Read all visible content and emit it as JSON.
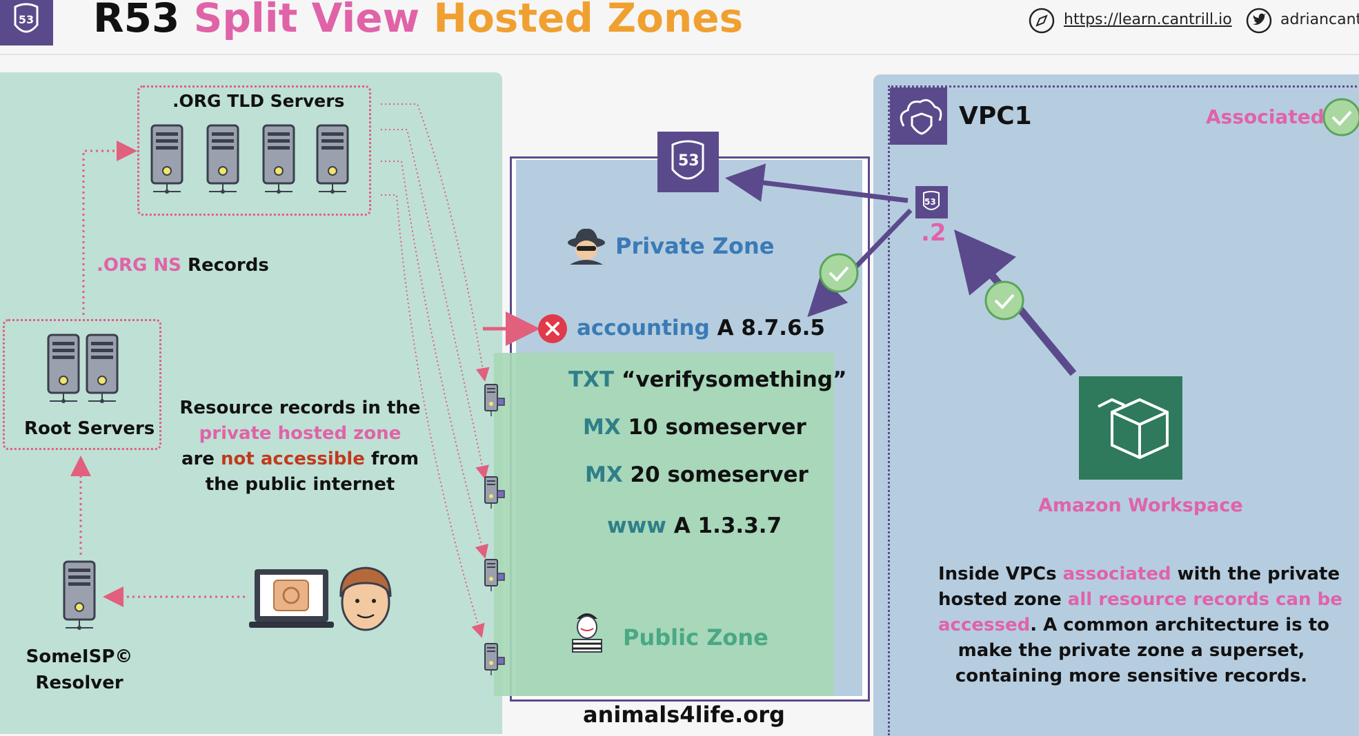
{
  "header": {
    "title_part1": "R53",
    "title_part2": "Split View",
    "title_part3": "Hosted Zones",
    "link_text": "https://learn.cantrill.io",
    "handle_text": "adriancantr"
  },
  "left_panel": {
    "tld_label": ".ORG TLD Servers",
    "ns_label_part1": ".ORG NS",
    "ns_label_part2": "Records",
    "root_label": "Root Servers",
    "resolver_line1": "SomeISP©",
    "resolver_line2": "Resolver",
    "note_line1": "Resource records in the",
    "note_line2": "private hosted zone",
    "note_line3_a": "are",
    "note_line3_b": "not accessible",
    "note_line3_c": "from",
    "note_line4": "the public internet"
  },
  "zone": {
    "r53_badge": "53",
    "private_label": "Private Zone",
    "public_label": "Public Zone",
    "domain": "animals4life.org",
    "records": [
      {
        "name": "accounting",
        "value": "A 8.7.6.5"
      },
      {
        "name": "TXT",
        "value": "“verifysomething”"
      },
      {
        "name": "MX",
        "value": "10 someserver"
      },
      {
        "name": "MX",
        "value": "20 someserver"
      },
      {
        "name": "www",
        "value": "A 1.3.3.7"
      }
    ]
  },
  "vpc": {
    "title": "VPC1",
    "associated": "Associated",
    "resolver_badge": "53",
    "resolver_ip": ".2",
    "workspace_label": "Amazon Workspace",
    "note_line1_a": "Inside VPCs",
    "note_line1_b": "associated",
    "note_line1_c": "with the private",
    "note_line2_a": "hosted zone",
    "note_line2_b": "all resource records can be",
    "note_line3_a": "accessed",
    "note_line3_b": ". A common architecture is to",
    "note_line4": "make the private zone a superset,",
    "note_line5": "containing more sensitive records."
  },
  "colors": {
    "pink": "#e063a8",
    "orange": "#f0a030",
    "purple": "#5b4a8b",
    "teal": "#2f7f88",
    "blue": "#3a7bb5",
    "green_label": "#4aa884",
    "red": "#c03a1c",
    "error": "#e0394a"
  }
}
